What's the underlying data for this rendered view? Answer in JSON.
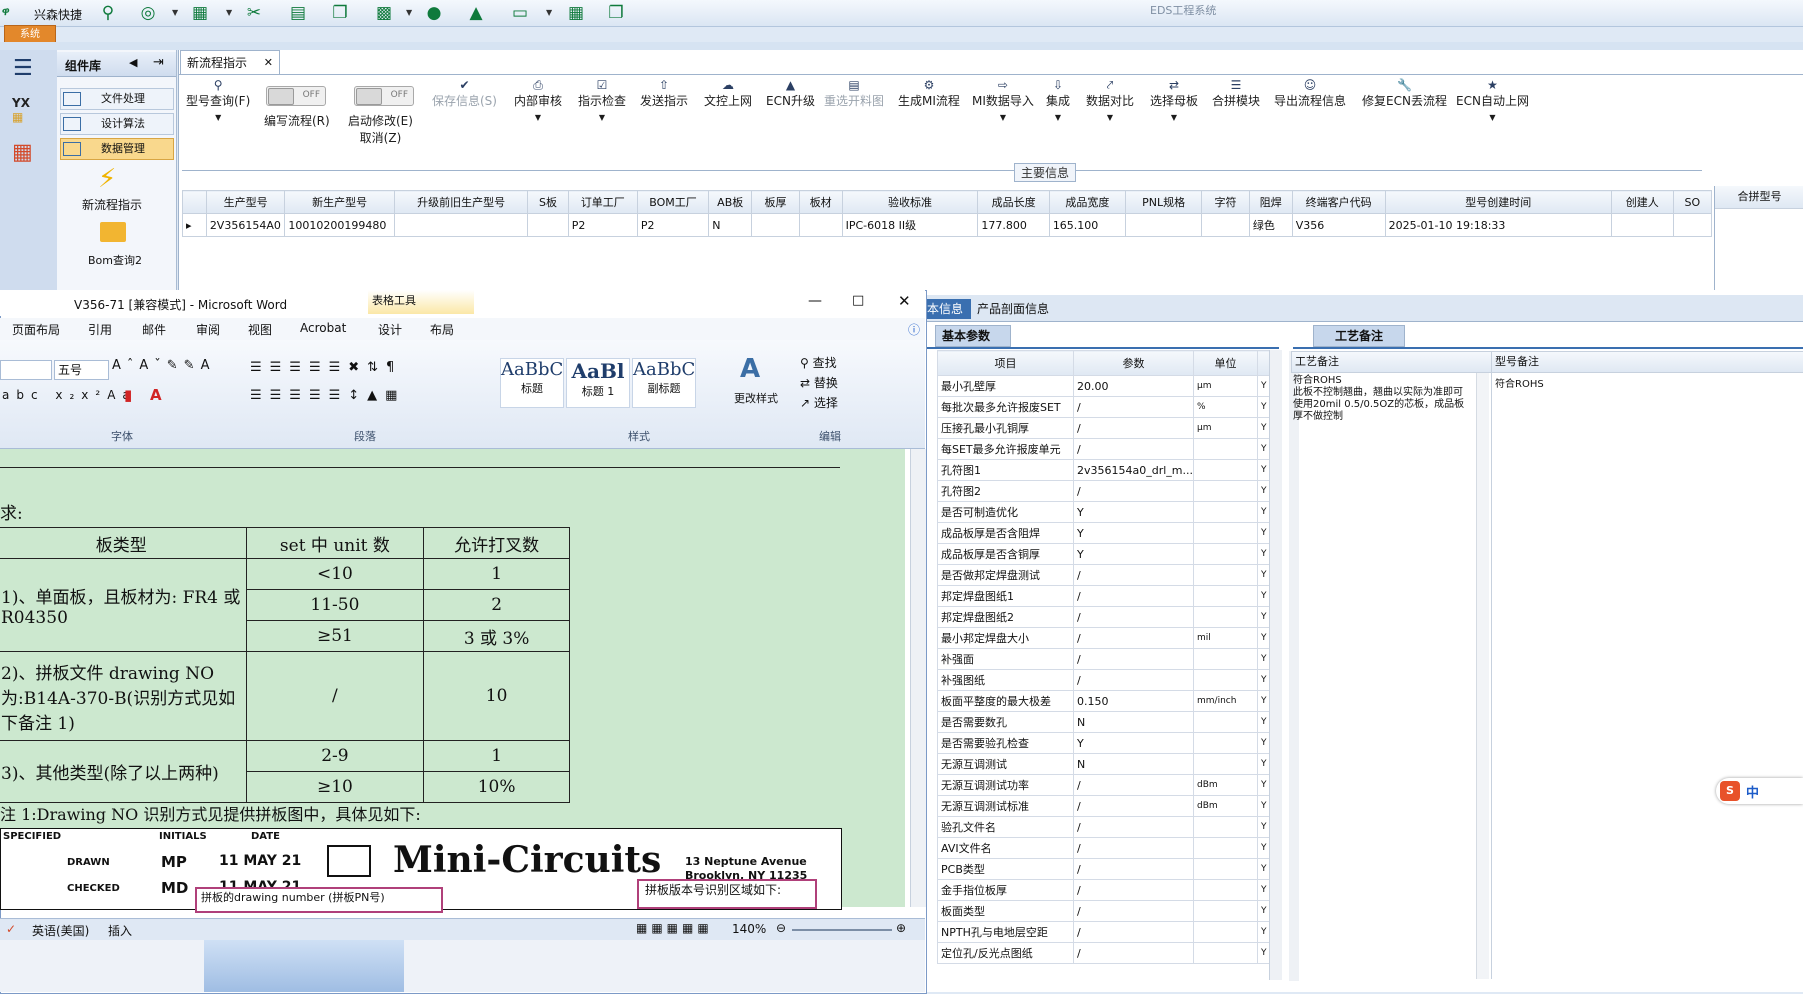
{
  "top": {
    "logo": "兴森快捷",
    "app_title": "EDS工程系统",
    "sys_button": "系统"
  },
  "modules": {
    "header": "组件库",
    "items": [
      {
        "label": "文件处理"
      },
      {
        "label": "设计算法"
      },
      {
        "label": "数据管理"
      }
    ],
    "tiles": [
      {
        "label": "新流程指示"
      },
      {
        "label": "Bom查询2"
      }
    ]
  },
  "main": {
    "tab_label": "新流程指示",
    "toggle_off": "OFF",
    "tools": [
      {
        "label": "型号查询(F)",
        "icon": "search-icon"
      },
      {
        "label": "编写流程(R)",
        "icon": "toggle"
      },
      {
        "label": "启动修改(E)",
        "label2": "取消(Z)",
        "icon": "toggle"
      },
      {
        "label": "保存信息(S)",
        "icon": "check-icon",
        "disabled": true
      },
      {
        "label": "内部审核",
        "icon": "print-icon"
      },
      {
        "label": "指示检查",
        "icon": "check-icon"
      },
      {
        "label": "发送指示",
        "icon": "upload-icon"
      },
      {
        "label": "文控上网",
        "icon": "cloud-upload-icon"
      },
      {
        "label": "ECN升级",
        "icon": "ecn-icon"
      },
      {
        "label": "重选开料图",
        "icon": "image-icon",
        "disabled": true
      },
      {
        "label": "生成MI流程",
        "icon": "gears-icon"
      },
      {
        "label": "MI数据导入",
        "icon": "import-icon"
      },
      {
        "label": "集成",
        "icon": "download-icon"
      },
      {
        "label": "数据对比",
        "icon": "compare-icon"
      },
      {
        "label": "选择母板",
        "icon": "shuffle-icon"
      },
      {
        "label": "合拼模块",
        "icon": "list-icon"
      },
      {
        "label": "导出流程信息",
        "icon": "smile-icon"
      },
      {
        "label": "修复ECN丢流程",
        "icon": "wrench-icon"
      },
      {
        "label": "ECN自动上网",
        "icon": "star-icon"
      }
    ],
    "group_label": "主要信息",
    "grid_headers": [
      "生产型号",
      "新生产型号",
      "升级前旧生产型号",
      "S板",
      "订单工厂",
      "BOM工厂",
      "AB板",
      "板厚",
      "板材",
      "验收标准",
      "成品长度",
      "成品宽度",
      "PNL规格",
      "字符",
      "阻焊",
      "终端客户代码",
      "型号创建时间",
      "创建人",
      "SO"
    ],
    "grid_row": [
      "2V356154A0",
      "10010200199480",
      "",
      "",
      "P2",
      "P2",
      "N",
      "",
      "",
      "IPC-6018 II级",
      "177.800",
      "165.100",
      "",
      "",
      "绿色",
      "V356",
      "2025-01-10 19:18:33",
      "",
      ""
    ],
    "side_header": "合拼型号"
  },
  "word": {
    "title": "V356-71 [兼容模式] - Microsoft Word",
    "context_tab": "表格工具",
    "menu": [
      "页面布局",
      "引用",
      "邮件",
      "审阅",
      "视图",
      "Acrobat",
      "设计",
      "布局"
    ],
    "font_size": "五号",
    "groups": {
      "font": "字体",
      "paragraph": "段落",
      "styles": "样式",
      "edit": "编辑"
    },
    "styles": [
      {
        "preview": "AaBbC",
        "name": "标题"
      },
      {
        "preview": "AaBl",
        "name": "标题 1"
      },
      {
        "preview": "AaBbC",
        "name": "副标题"
      }
    ],
    "change_styles": "更改样式",
    "edit_items": [
      "查找",
      "替换",
      "选择"
    ],
    "doc": {
      "req_label": "求:",
      "table_headers": [
        "板类型",
        "set 中 unit 数",
        "允许打叉数"
      ],
      "rows": [
        {
          "type": "1)、单面板，且板材为: FR4 或 R04350",
          "units": [
            "<10",
            "11-50",
            "≥51"
          ],
          "allow": [
            "1",
            "2",
            "3 或 3%"
          ]
        },
        {
          "type": "2)、拼板文件 drawing NO 为:B14A-370-B(识别方式见如下备注 1)",
          "units": [
            "/"
          ],
          "allow": [
            "10"
          ]
        },
        {
          "type": "3)、其他类型(除了以上两种)",
          "units": [
            "2-9",
            "≥10"
          ],
          "allow": [
            "1",
            "10%"
          ]
        }
      ],
      "note": "注 1:Drawing NO 识别方式见提供拼板图中，具体见如下:",
      "mc_brand": "Mini-Circuits",
      "mc_address1": "13 Neptune Avenue",
      "mc_address2": "Brooklyn, NY 11235",
      "mc_left_cols": [
        "SPECIFIED",
        "INITIALS",
        "DATE"
      ],
      "mc_rows": [
        [
          "DRAWN",
          "MP",
          "11 MAY 21"
        ],
        [
          "CHECKED",
          "MD",
          "11 MAY 21"
        ]
      ],
      "callout1": "拼板的drawing number (拼板PN号)",
      "callout2": "拼板版本号识别区域如下:"
    },
    "status_lang": "英语(美国)",
    "status_insert": "插入",
    "zoom": "140%"
  },
  "right": {
    "tabs": [
      "本信息",
      "产品剖面信息"
    ],
    "left_tab": "基本参数",
    "right_tab": "工艺备注",
    "param_headers": [
      "项目",
      "参数",
      "单位"
    ],
    "params": [
      [
        "最小孔壁厚",
        "20.00",
        "μm"
      ],
      [
        "每批次最多允许报废SET",
        "/",
        "%"
      ],
      [
        "压接孔最小孔铜厚",
        "/",
        "μm"
      ],
      [
        "每SET最多允许报废单元",
        "/",
        ""
      ],
      [
        "孔符图1",
        "2v356154a0_drl_m...",
        ""
      ],
      [
        "孔符图2",
        "/",
        ""
      ],
      [
        "是否可制造优化",
        "Y",
        ""
      ],
      [
        "成品板厚是否含阻焊",
        "Y",
        ""
      ],
      [
        "成品板厚是否含铜厚",
        "Y",
        ""
      ],
      [
        "是否做邦定焊盘测试",
        "/",
        ""
      ],
      [
        "邦定焊盘图纸1",
        "/",
        ""
      ],
      [
        "邦定焊盘图纸2",
        "/",
        ""
      ],
      [
        "最小邦定焊盘大小",
        "/",
        "mil"
      ],
      [
        "补强面",
        "/",
        ""
      ],
      [
        "补强图纸",
        "/",
        ""
      ],
      [
        "板面平整度的最大极差",
        "0.150",
        "mm/inch"
      ],
      [
        "是否需要数孔",
        "N",
        ""
      ],
      [
        "是否需要验孔检查",
        "Y",
        ""
      ],
      [
        "无源互调测试",
        "N",
        ""
      ],
      [
        "无源互调测试功率",
        "/",
        "dBm"
      ],
      [
        "无源互调测试标准",
        "/",
        "dBm"
      ],
      [
        "验孔文件名",
        "/",
        ""
      ],
      [
        "AVI文件名",
        "/",
        ""
      ],
      [
        "PCB类型",
        "/",
        ""
      ],
      [
        "金手指位板厚",
        "/",
        ""
      ],
      [
        "板面类型",
        "/",
        ""
      ],
      [
        "NPTH孔与电地层空距",
        "/",
        ""
      ],
      [
        "定位孔/反光点图纸",
        "/",
        ""
      ]
    ],
    "flag": "Y",
    "remark_headers": [
      "工艺备注",
      "型号备注"
    ],
    "remark_text": [
      "符合ROHS",
      "此板不控制翘曲，翘曲以实际为准即可",
      "使用20mil 0.5/0.5OZ的芯板，成品板厚不做控制"
    ],
    "model_remark": "符合ROHS"
  },
  "ime": {
    "label": "中"
  }
}
